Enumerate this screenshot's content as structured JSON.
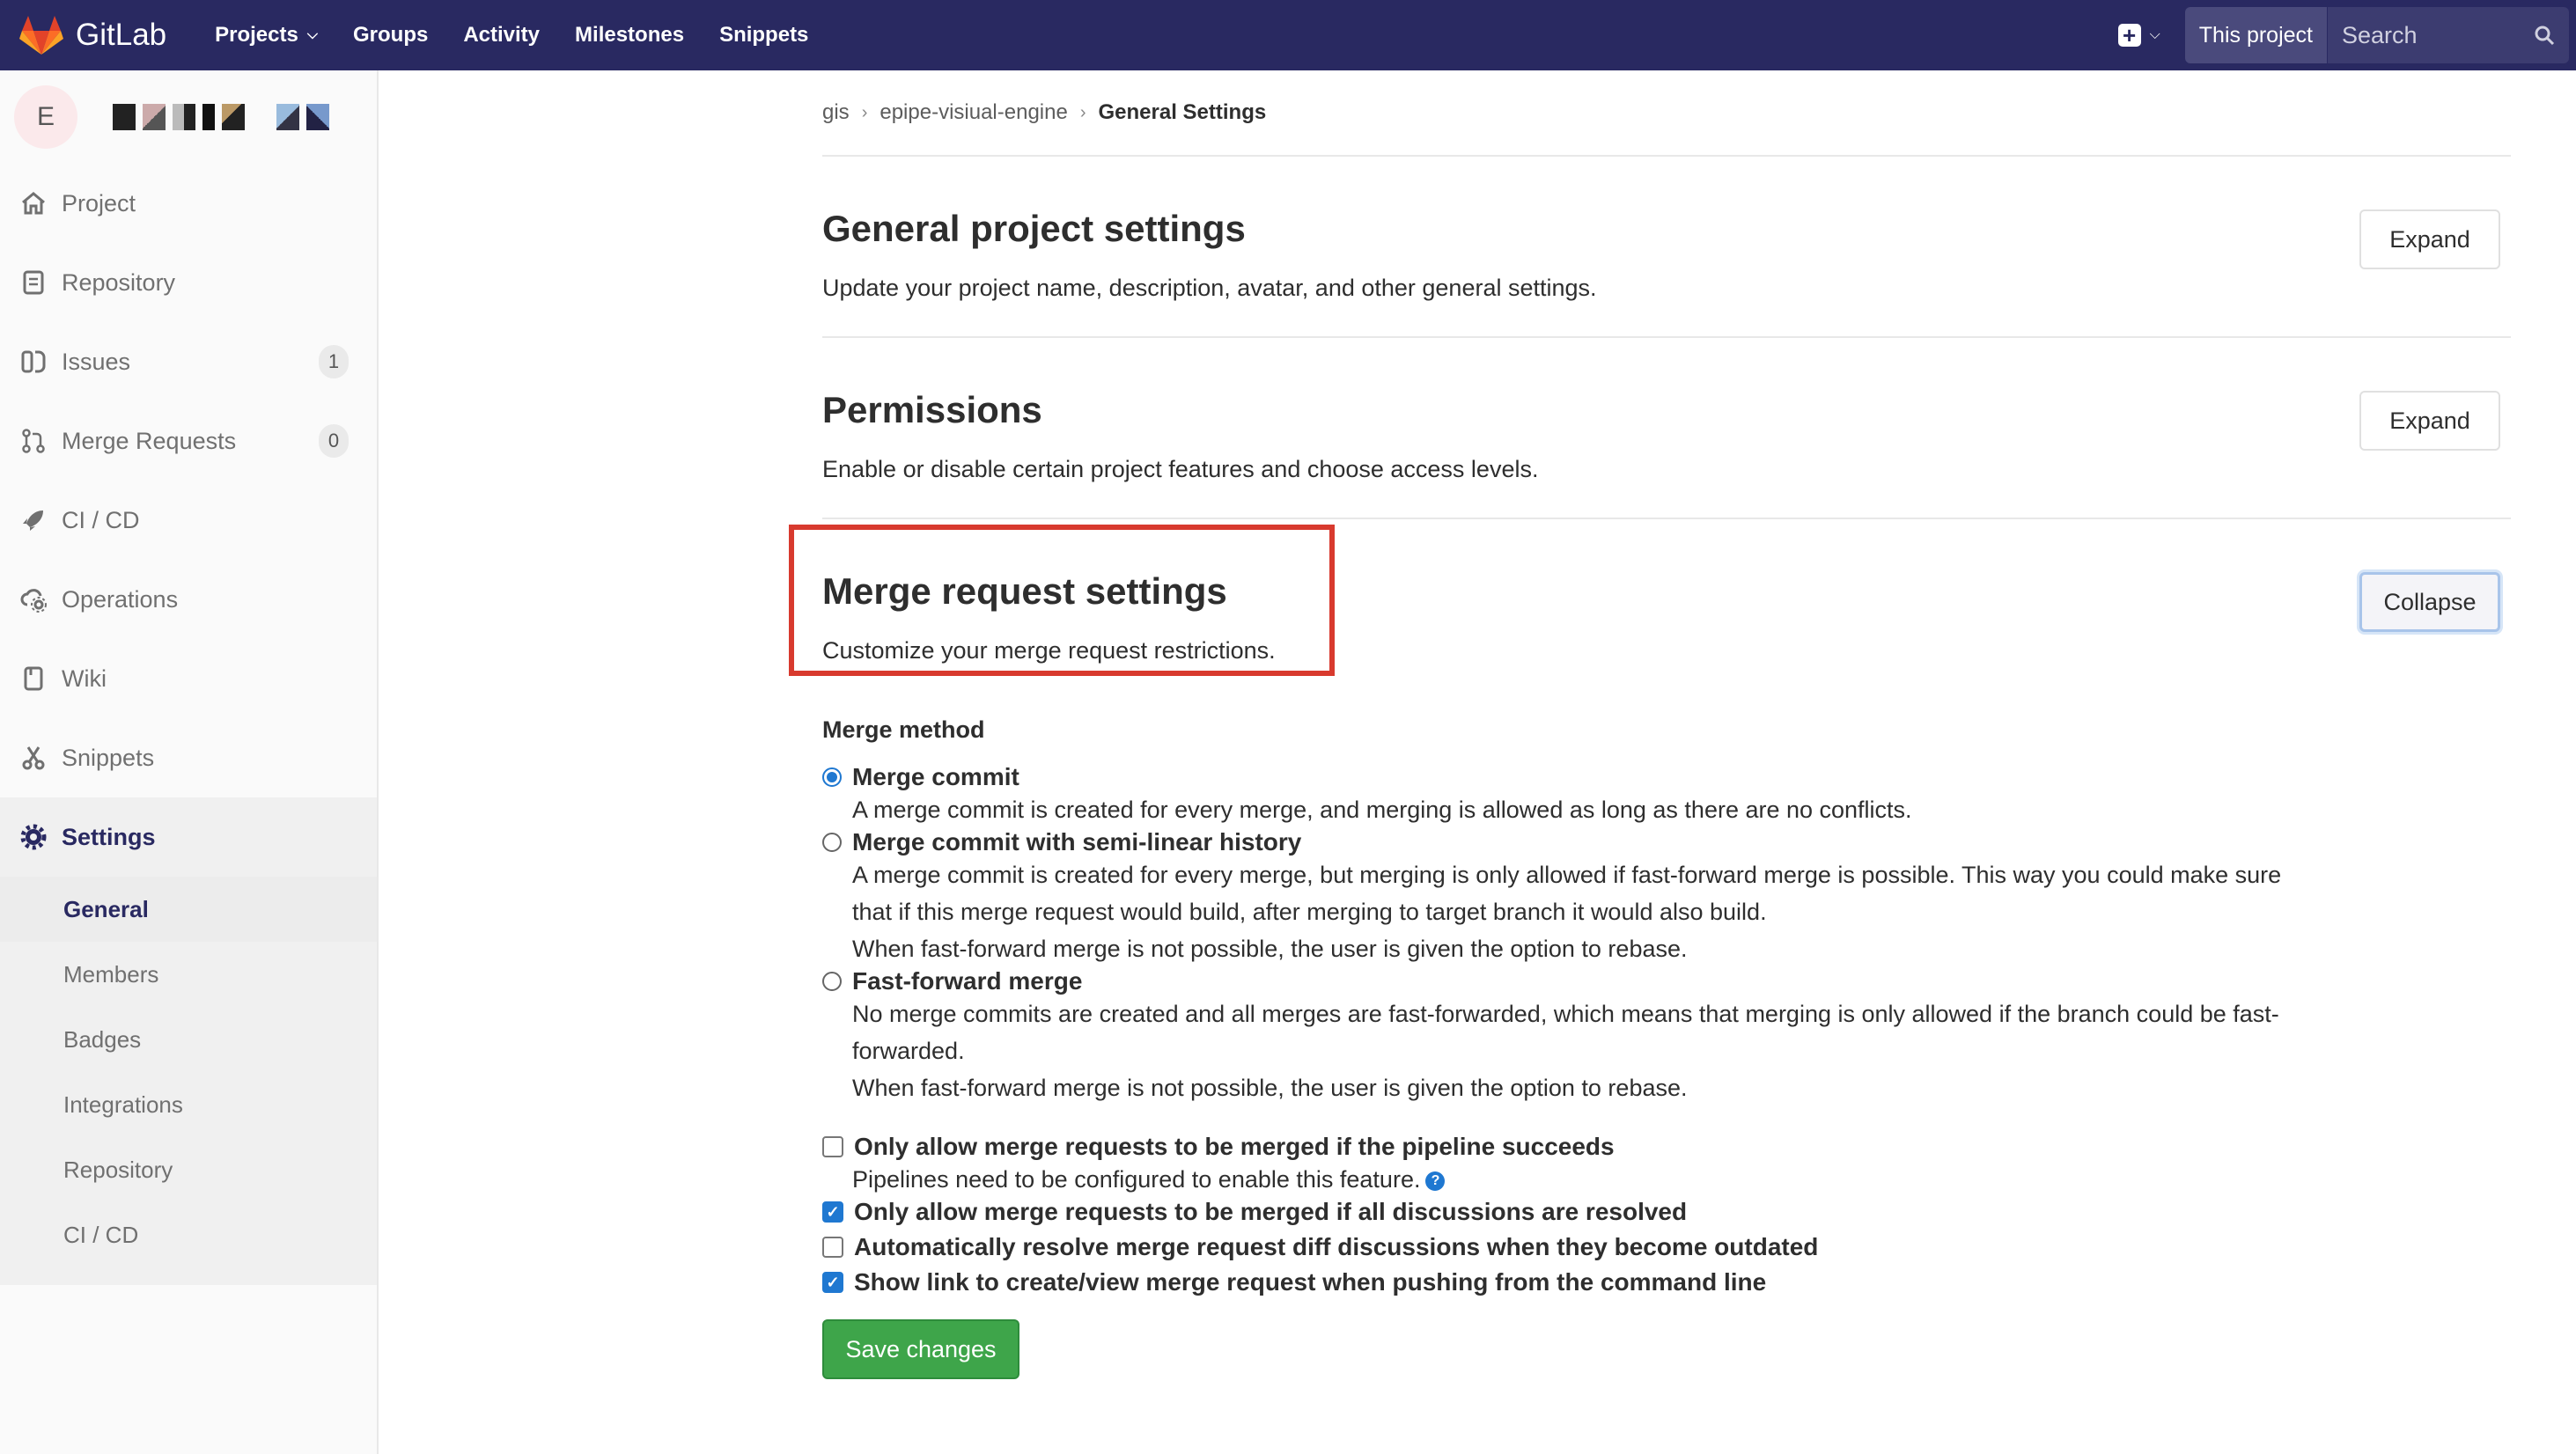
{
  "navbar": {
    "brand": "GitLab",
    "links": [
      {
        "label": "Projects",
        "dropdown": true
      },
      {
        "label": "Groups"
      },
      {
        "label": "Activity"
      },
      {
        "label": "Milestones"
      },
      {
        "label": "Snippets"
      }
    ],
    "search_scope": "This project",
    "search_placeholder": "Search",
    "colors": {
      "background": "#292961",
      "brand_orange": "#e24329"
    }
  },
  "sidebar": {
    "avatar_letter": "E",
    "items": [
      {
        "label": "Project",
        "icon": "home-icon"
      },
      {
        "label": "Repository",
        "icon": "document-icon"
      },
      {
        "label": "Issues",
        "icon": "issues-icon",
        "count": "1"
      },
      {
        "label": "Merge Requests",
        "icon": "merge-request-icon",
        "count": "0"
      },
      {
        "label": "CI / CD",
        "icon": "rocket-icon"
      },
      {
        "label": "Operations",
        "icon": "cloud-gear-icon"
      },
      {
        "label": "Wiki",
        "icon": "book-icon"
      },
      {
        "label": "Snippets",
        "icon": "scissors-icon"
      }
    ],
    "settings": {
      "label": "Settings",
      "icon": "gear-icon",
      "subitems": [
        "General",
        "Members",
        "Badges",
        "Integrations",
        "Repository",
        "CI / CD"
      ],
      "active": "General"
    }
  },
  "breadcrumb": [
    "gis",
    "epipe-visiual-engine",
    "General Settings"
  ],
  "sections": [
    {
      "title": "General project settings",
      "desc": "Update your project name, description, avatar, and other general settings.",
      "button": "Expand"
    },
    {
      "title": "Permissions",
      "desc": "Enable or disable certain project features and choose access levels.",
      "button": "Expand"
    },
    {
      "title": "Merge request settings",
      "desc": "Customize your merge request restrictions.",
      "button": "Collapse"
    }
  ],
  "merge_form": {
    "method_label": "Merge method",
    "methods": [
      {
        "label": "Merge commit",
        "selected": true,
        "help": [
          "A merge commit is created for every merge, and merging is allowed as long as there are no conflicts."
        ]
      },
      {
        "label": "Merge commit with semi-linear history",
        "selected": false,
        "help": [
          "A merge commit is created for every merge, but merging is only allowed if fast-forward merge is possible. This way you could make sure that if this merge request would build, after merging to target branch it would also build.",
          "When fast-forward merge is not possible, the user is given the option to rebase."
        ]
      },
      {
        "label": "Fast-forward merge",
        "selected": false,
        "help": [
          "No merge commits are created and all merges are fast-forwarded, which means that merging is only allowed if the branch could be fast-forwarded.",
          "When fast-forward merge is not possible, the user is given the option to rebase."
        ]
      }
    ],
    "checkboxes": [
      {
        "label": "Only allow merge requests to be merged if the pipeline succeeds",
        "checked": false,
        "help": "Pipelines need to be configured to enable this feature."
      },
      {
        "label": "Only allow merge requests to be merged if all discussions are resolved",
        "checked": true
      },
      {
        "label": "Automatically resolve merge request diff discussions when they become outdated",
        "checked": false
      },
      {
        "label": "Show link to create/view merge request when pushing from the command line",
        "checked": true
      }
    ],
    "save_label": "Save changes",
    "colors": {
      "accent": "#1f78d1",
      "save": "#3ea54a",
      "highlight": "#d83a2e"
    }
  }
}
